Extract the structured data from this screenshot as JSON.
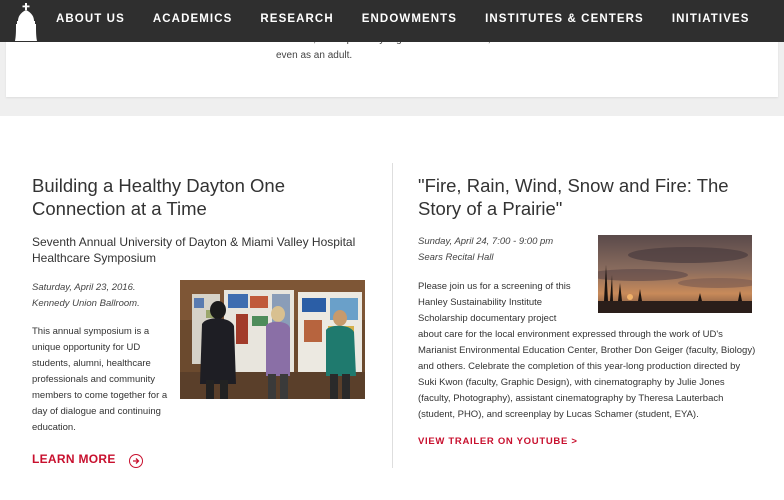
{
  "nav": {
    "items": [
      "ABOUT US",
      "ACADEMICS",
      "RESEARCH",
      "ENDOWMENTS",
      "INSTITUTES & CENTERS",
      "INITIATIVES"
    ]
  },
  "top_card": {
    "clipped_line": "however, can repeatedly regenerate lost tissues,",
    "text": "even as an adult."
  },
  "event_left": {
    "title": "Building a Healthy Dayton One Connection at a Time",
    "subtitle": "Seventh Annual University of Dayton & Miami Valley Hospital Healthcare Symposium",
    "date": "Saturday, April 23, 2016.",
    "location": "Kennedy Union Ballroom.",
    "body": "This annual symposium is a unique opportunity for UD students, alumni, healthcare professionals and community members to come together for a day of dialogue and continuing education.",
    "link_label": "LEARN MORE"
  },
  "event_right": {
    "title": "\"Fire, Rain, Wind, Snow and Fire: The Story of a Prairie\"",
    "date": "Sunday, April 24, 7:00 - 9:00 pm",
    "location": "Sears Recital Hall",
    "body_short": "Please join us for a screening of this Hanley Sustainability Institute Scholarship documentary project",
    "body_full": "about care for the local environment expressed through the work of UD's Marianist Environmental Education Center, Brother Don Geiger (faculty, Biology) and others. Celebrate the completion of this year-long production directed by Suki Kwon (faculty, Graphic Design), with cinematography by Julie Jones (faculty, Photography), assistant cinematography by Theresa Lauterbach (student, PHO), and screenplay by Lucas Schamer (student, EYA).",
    "link_label": "VIEW TRAILER ON YOUTUBE >"
  },
  "colors": {
    "accent": "#c8102e",
    "nav_bg": "#2f2f2f"
  }
}
